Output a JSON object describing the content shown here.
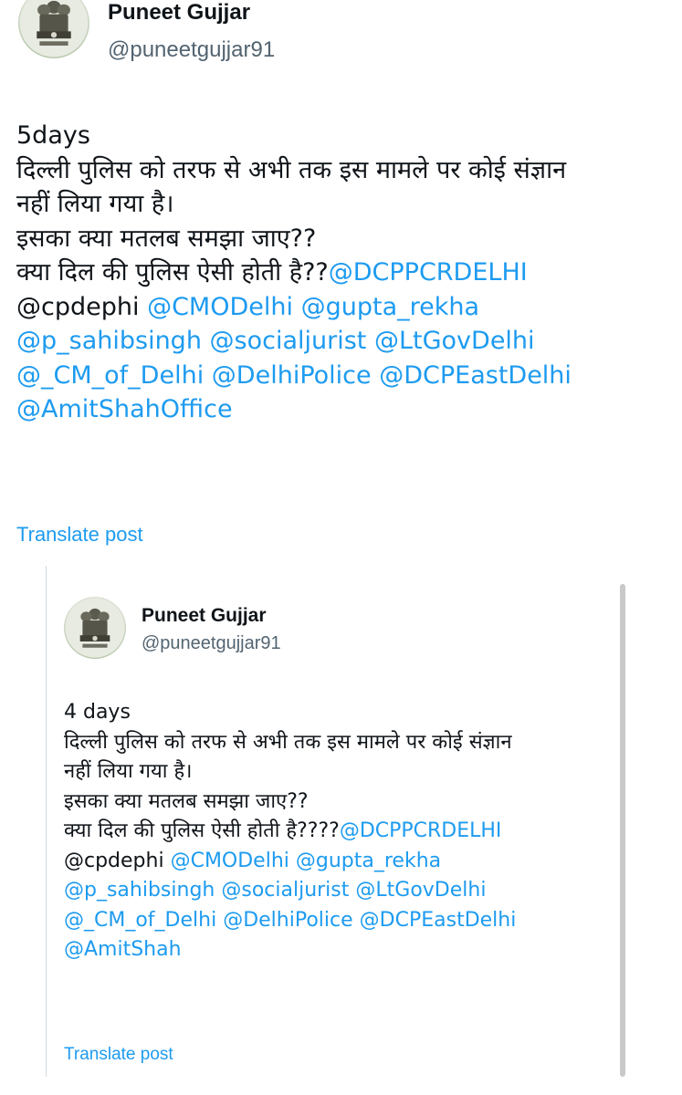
{
  "main_tweet": {
    "name": "Puneet Gujjar",
    "handle": "@puneetgujjar91",
    "lines": [
      [
        {
          "t": "5days",
          "link": false
        }
      ],
      [
        {
          "t": "दिल्ली पुलिस को तरफ से अभी तक इस मामले पर कोई संज्ञान",
          "link": false
        }
      ],
      [
        {
          "t": "नहीं लिया गया है।",
          "link": false
        }
      ],
      [
        {
          "t": "इसका क्या मतलब समझा जाए??",
          "link": false
        }
      ],
      [
        {
          "t": "क्या दिल की पुलिस ऐसी होती है??",
          "link": false
        },
        {
          "t": "@DCPPCRDELHI",
          "link": true
        }
      ],
      [
        {
          "t": "@cpdephi ",
          "link": false
        },
        {
          "t": "@CMODelhi",
          "link": true
        },
        {
          "t": " ",
          "link": false
        },
        {
          "t": "@gupta_rekha",
          "link": true
        }
      ],
      [
        {
          "t": "@p_sahibsingh",
          "link": true
        },
        {
          "t": " ",
          "link": false
        },
        {
          "t": "@socialjurist",
          "link": true
        },
        {
          "t": " ",
          "link": false
        },
        {
          "t": "@LtGovDelhi",
          "link": true
        }
      ],
      [
        {
          "t": "@_CM_of_Delhi",
          "link": true
        },
        {
          "t": " ",
          "link": false
        },
        {
          "t": "@DelhiPolice",
          "link": true
        },
        {
          "t": " ",
          "link": false
        },
        {
          "t": "@DCPEastDelhi",
          "link": true
        }
      ],
      [
        {
          "t": "@AmitShahOffice",
          "link": true
        }
      ]
    ],
    "translate_label": "Translate post"
  },
  "quoted_tweet": {
    "name": "Puneet Gujjar",
    "handle": "@puneetgujjar91",
    "lines": [
      [
        {
          "t": "4 days",
          "link": false
        }
      ],
      [
        {
          "t": "दिल्ली पुलिस को तरफ से अभी तक इस मामले पर कोई संज्ञान",
          "link": false
        }
      ],
      [
        {
          "t": "नहीं लिया गया है।",
          "link": false
        }
      ],
      [
        {
          "t": "इसका क्या मतलब समझा जाए??",
          "link": false
        }
      ],
      [
        {
          "t": "क्या दिल की पुलिस ऐसी होती है????",
          "link": false
        },
        {
          "t": "@DCPPCRDELHI",
          "link": true
        }
      ],
      [
        {
          "t": "@cpdephi ",
          "link": false
        },
        {
          "t": "@CMODelhi",
          "link": true
        },
        {
          "t": " ",
          "link": false
        },
        {
          "t": "@gupta_rekha",
          "link": true
        }
      ],
      [
        {
          "t": "@p_sahibsingh",
          "link": true
        },
        {
          "t": " ",
          "link": false
        },
        {
          "t": "@socialjurist",
          "link": true
        },
        {
          "t": " ",
          "link": false
        },
        {
          "t": "@LtGovDelhi",
          "link": true
        }
      ],
      [
        {
          "t": "@_CM_of_Delhi",
          "link": true
        },
        {
          "t": " ",
          "link": false
        },
        {
          "t": "@DelhiPolice",
          "link": true
        },
        {
          "t": " ",
          "link": false
        },
        {
          "t": "@DCPEastDelhi",
          "link": true
        }
      ],
      [
        {
          "t": "@AmitShah",
          "link": true
        }
      ]
    ],
    "translate_label": "Translate post"
  },
  "colors": {
    "link": "#1d9bf0",
    "text": "#0f1419",
    "secondary": "#536471"
  },
  "icons": {
    "avatar": "national-emblem-icon"
  }
}
